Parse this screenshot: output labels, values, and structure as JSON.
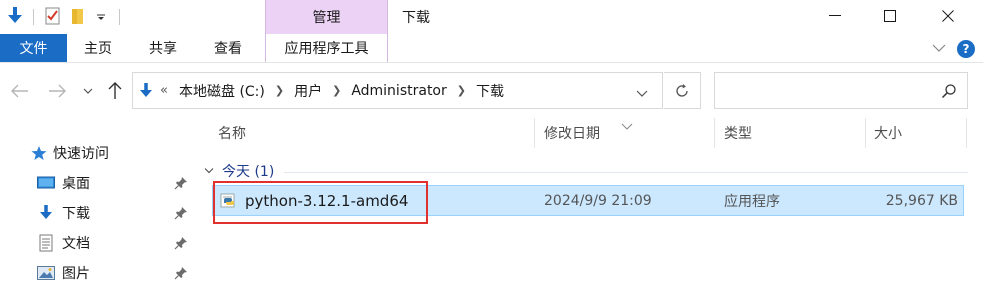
{
  "window": {
    "contextual_group": "管理",
    "title": "下载",
    "controls": {
      "minimize": "—",
      "maximize": "☐",
      "close": "✕"
    }
  },
  "ribbon": {
    "file_tab": "文件",
    "tabs": [
      "主页",
      "共享",
      "查看"
    ],
    "contextual_tab": "应用程序工具",
    "help": "?"
  },
  "address": {
    "overflow": "«",
    "crumbs": [
      "本地磁盘 (C:)",
      "用户",
      "Administrator",
      "下载"
    ],
    "search_placeholder": ""
  },
  "navpane": {
    "items": [
      {
        "label": "快速访问",
        "icon": "star-icon",
        "pinned": false
      },
      {
        "label": "桌面",
        "icon": "desktop-icon",
        "pinned": true
      },
      {
        "label": "下载",
        "icon": "download-icon",
        "pinned": true
      },
      {
        "label": "文档",
        "icon": "document-icon",
        "pinned": true
      },
      {
        "label": "图片",
        "icon": "pictures-icon",
        "pinned": true
      }
    ]
  },
  "filelist": {
    "columns": [
      "名称",
      "修改日期",
      "类型",
      "大小"
    ],
    "group_label": "今天 (1)",
    "rows": [
      {
        "name": "python-3.12.1-amd64",
        "modified": "2024/9/9 21:09",
        "type": "应用程序",
        "size": "25,967 KB",
        "icon": "python-installer-icon",
        "selected": true
      }
    ]
  },
  "colors": {
    "file_tab_bg": "#1a6cc4",
    "contextual_tab_bg": "#ecd2f5",
    "selection_bg": "#cce8ff",
    "selection_border": "#99d1ff",
    "highlight_box": "#e0312f",
    "group_text": "#1e3a8a"
  }
}
